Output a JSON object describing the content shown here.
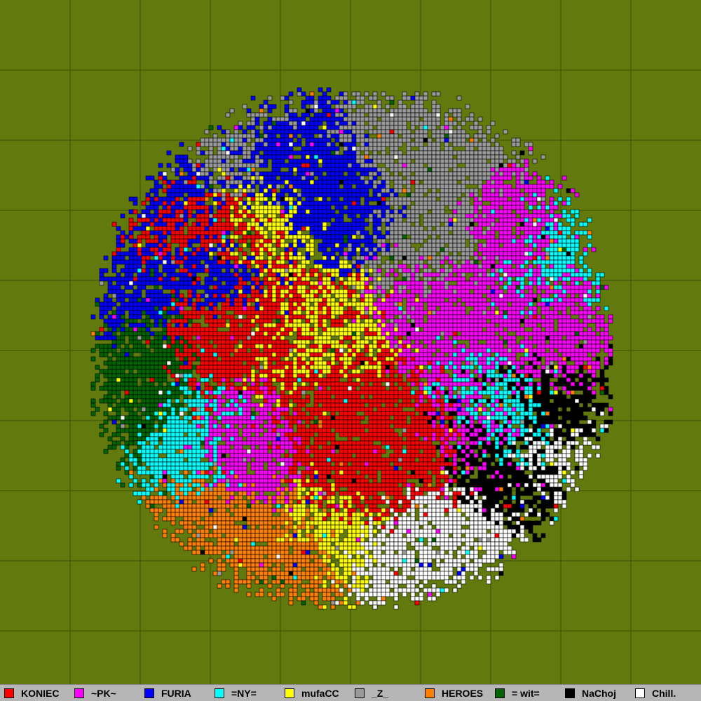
{
  "map": {
    "background_color": "#627a0d",
    "grid_color": "#3f5006",
    "empty_color": "#627a0d"
  },
  "legend": {
    "items": [
      {
        "label": "KONIEC",
        "color": "#ff0000"
      },
      {
        "label": "~PK~",
        "color": "#ff00ff"
      },
      {
        "label": "FURIA",
        "color": "#0000ff"
      },
      {
        "label": "=NY=",
        "color": "#00ffff"
      },
      {
        "label": "mufaCC",
        "color": "#ffff00"
      },
      {
        "label": "_Z_",
        "color": "#999999"
      },
      {
        "label": "HEROES",
        "color": "#ff8000"
      },
      {
        "label": "= wit=",
        "color": "#006400"
      },
      {
        "label": "NaChoj",
        "color": "#000000"
      },
      {
        "label": "Chill.",
        "color": "#ffffff"
      }
    ]
  }
}
